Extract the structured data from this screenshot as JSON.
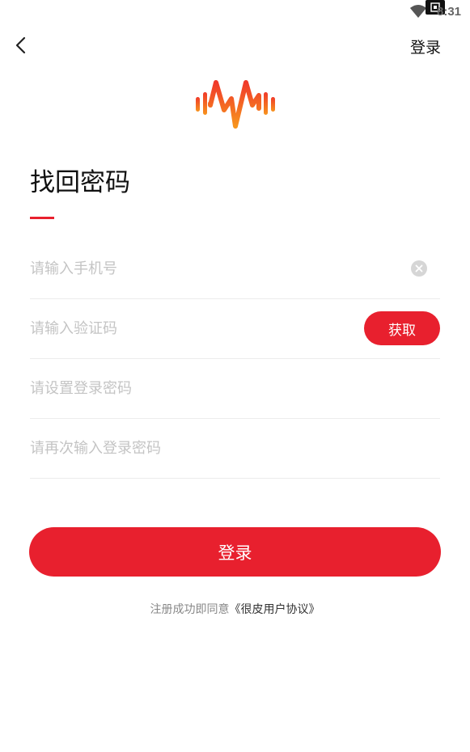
{
  "status_bar": {
    "time": "8:31",
    "icons": [
      "wifi-icon",
      "screenshot-icon"
    ]
  },
  "header": {
    "back_icon": "chevron-left-icon",
    "login_label": "登录"
  },
  "logo": {
    "icon": "waveform-logo-icon",
    "colors": [
      "#f0392a",
      "#f7941d"
    ]
  },
  "title": "找回密码",
  "accent_color": "#e8202e",
  "form": {
    "phone_placeholder": "请输入手机号",
    "phone_value": "",
    "code_placeholder": "请输入验证码",
    "code_value": "",
    "get_code_label": "获取",
    "password_placeholder": "请设置登录密码",
    "password_value": "",
    "confirm_placeholder": "请再次输入登录密码",
    "confirm_value": ""
  },
  "submit_label": "登录",
  "agreement": {
    "prefix": "注册成功即同意",
    "link": "《很皮用户协议》"
  }
}
